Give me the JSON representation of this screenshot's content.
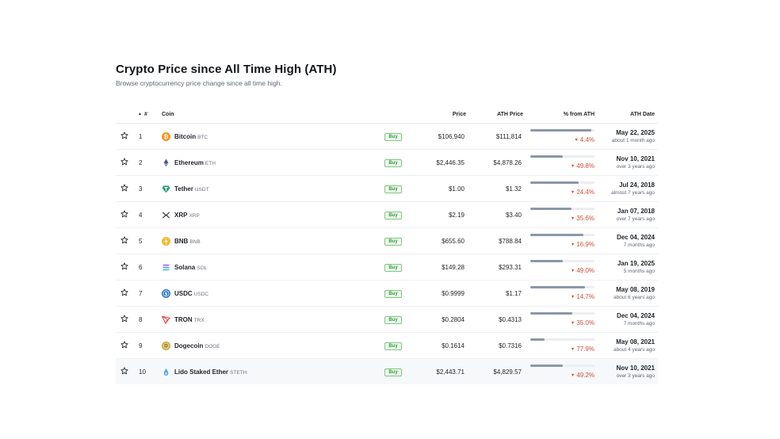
{
  "page": {
    "title": "Crypto Price since All Time High (ATH)",
    "subtitle": "Browse cryptocurrency price change since all time high."
  },
  "table": {
    "headers": {
      "rank": "#",
      "coin": "Coin",
      "price": "Price",
      "ath_price": "ATH Price",
      "pct_from_ath": "% from ATH",
      "ath_date": "ATH Date"
    },
    "sort_icon": "sort-up-caret-icon",
    "buy_label": "Buy",
    "pct_arrow": "▼",
    "rows": [
      {
        "rank": "1",
        "name": "Bitcoin",
        "symbol": "BTC",
        "icon": "bitcoin-logo-icon",
        "price": "$106,940",
        "ath_price": "$111,814",
        "pct": "4.4%",
        "pct_value": 4.4,
        "ath_date": "May 22, 2025",
        "ago": "about 1 month ago"
      },
      {
        "rank": "2",
        "name": "Ethereum",
        "symbol": "ETH",
        "icon": "ethereum-logo-icon",
        "price": "$2,446.35",
        "ath_price": "$4,878.26",
        "pct": "49.8%",
        "pct_value": 49.8,
        "ath_date": "Nov 10, 2021",
        "ago": "over 3 years ago"
      },
      {
        "rank": "3",
        "name": "Tether",
        "symbol": "USDT",
        "icon": "tether-logo-icon",
        "price": "$1.00",
        "ath_price": "$1.32",
        "pct": "24.4%",
        "pct_value": 24.4,
        "ath_date": "Jul 24, 2018",
        "ago": "almost 7 years ago"
      },
      {
        "rank": "4",
        "name": "XRP",
        "symbol": "XRP",
        "icon": "xrp-logo-icon",
        "price": "$2.19",
        "ath_price": "$3.40",
        "pct": "35.6%",
        "pct_value": 35.6,
        "ath_date": "Jan 07, 2018",
        "ago": "over 7 years ago"
      },
      {
        "rank": "5",
        "name": "BNB",
        "symbol": "BNB",
        "icon": "bnb-logo-icon",
        "price": "$655.60",
        "ath_price": "$788.84",
        "pct": "16.9%",
        "pct_value": 16.9,
        "ath_date": "Dec 04, 2024",
        "ago": "7 months ago"
      },
      {
        "rank": "6",
        "name": "Solana",
        "symbol": "SOL",
        "icon": "solana-logo-icon",
        "price": "$149.28",
        "ath_price": "$293.31",
        "pct": "49.0%",
        "pct_value": 49.0,
        "ath_date": "Jan 19, 2025",
        "ago": "5 months ago"
      },
      {
        "rank": "7",
        "name": "USDC",
        "symbol": "USDC",
        "icon": "usdc-logo-icon",
        "price": "$0.9999",
        "ath_price": "$1.17",
        "pct": "14.7%",
        "pct_value": 14.7,
        "ath_date": "May 08, 2019",
        "ago": "about 6 years ago"
      },
      {
        "rank": "8",
        "name": "TRON",
        "symbol": "TRX",
        "icon": "tron-logo-icon",
        "price": "$0.2804",
        "ath_price": "$0.4313",
        "pct": "35.0%",
        "pct_value": 35.0,
        "ath_date": "Dec 04, 2024",
        "ago": "7 months ago"
      },
      {
        "rank": "9",
        "name": "Dogecoin",
        "symbol": "DOGE",
        "icon": "dogecoin-logo-icon",
        "price": "$0.1614",
        "ath_price": "$0.7316",
        "pct": "77.9%",
        "pct_value": 77.9,
        "ath_date": "May 08, 2021",
        "ago": "about 4 years ago"
      },
      {
        "rank": "10",
        "name": "Lido Staked Ether",
        "symbol": "STETH",
        "icon": "lido-steth-logo-icon",
        "price": "$2,443.71",
        "ath_price": "$4,829.57",
        "pct": "49.2%",
        "pct_value": 49.2,
        "ath_date": "Nov 10, 2021",
        "ago": "over 3 years ago"
      }
    ]
  },
  "colors": {
    "negative": "#d64a3b",
    "buy_green": "#2e9a37",
    "bar_fill": "#8a97aa",
    "bar_track": "#eceef1"
  }
}
